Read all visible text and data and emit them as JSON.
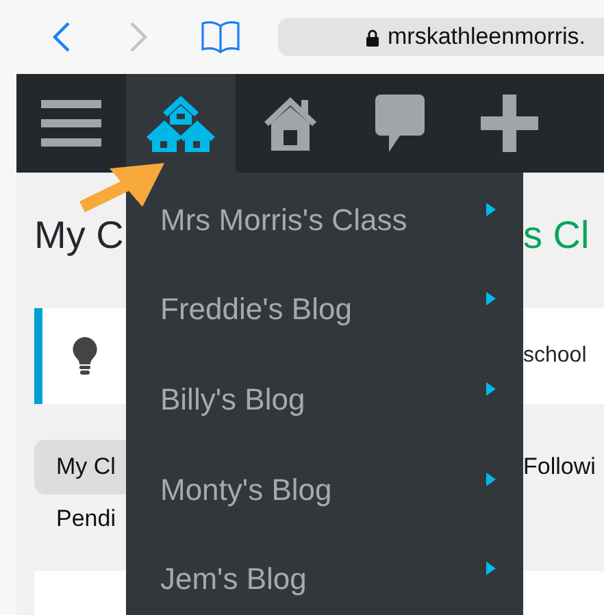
{
  "browser": {
    "url": "mrskathleenmorris."
  },
  "admin_bar": {
    "items": [
      {
        "kind": "menu",
        "selected": false
      },
      {
        "kind": "sites",
        "selected": true
      },
      {
        "kind": "home",
        "selected": false
      },
      {
        "kind": "comments",
        "selected": false
      },
      {
        "kind": "new",
        "selected": false
      }
    ]
  },
  "dropdown": {
    "items": [
      {
        "label": "Mrs Morris's Class",
        "has_submenu": true
      },
      {
        "label": "Freddie's Blog",
        "has_submenu": true
      },
      {
        "label": "Billy's Blog",
        "has_submenu": true
      },
      {
        "label": "Monty's Blog",
        "has_submenu": true
      },
      {
        "label": "Jem's Blog",
        "has_submenu": true
      }
    ]
  },
  "page": {
    "title_left": "My C",
    "title_right": "s Cl",
    "notice_text": "school",
    "tabs": [
      {
        "label": "My Cl",
        "selected": true
      },
      {
        "label": "Followi",
        "selected": false
      }
    ],
    "pending": "Pendi"
  }
}
